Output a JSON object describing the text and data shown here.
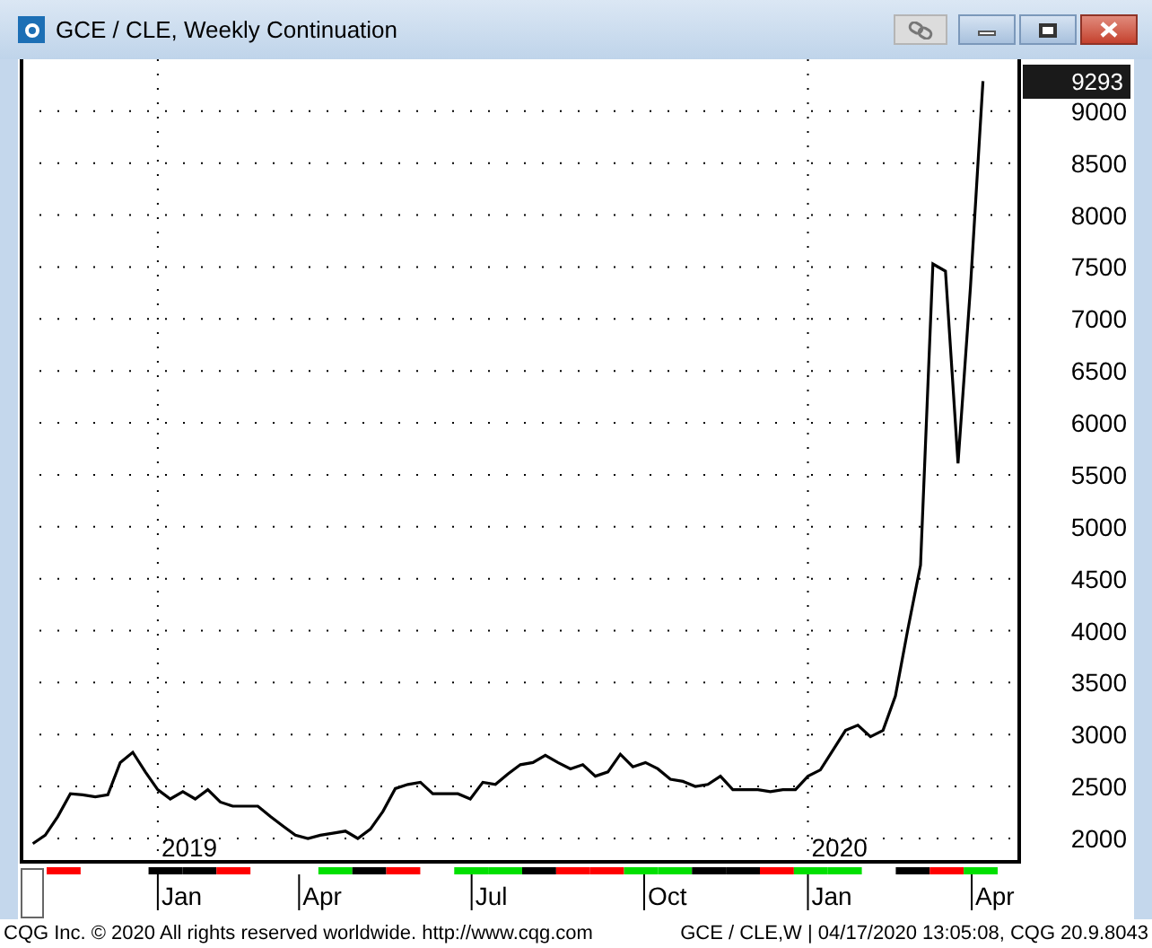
{
  "window": {
    "title": "GCE / CLE, Weekly Continuation"
  },
  "chart": {
    "last_price": "9293",
    "year_labels": [
      "2019",
      "2020"
    ],
    "time_axis": [
      {
        "label": "Jan"
      },
      {
        "label": "Apr"
      },
      {
        "label": "Jul"
      },
      {
        "label": "Oct"
      },
      {
        "label": "Jan"
      },
      {
        "label": "Apr"
      }
    ],
    "chart_data": {
      "type": "line",
      "grid": true,
      "ylim": [
        1775,
        9500
      ],
      "yticks": [
        2000,
        2500,
        3000,
        3500,
        4000,
        4500,
        5000,
        5500,
        6000,
        6500,
        7000,
        7500,
        8000,
        8500,
        9000
      ],
      "series": [
        {
          "color": "#000000",
          "values": [
            1950,
            2030,
            2210,
            2430,
            2420,
            2400,
            2420,
            2730,
            2830,
            2640,
            2470,
            2380,
            2450,
            2380,
            2470,
            2350,
            2310,
            2310,
            2310,
            2210,
            2120,
            2030,
            2000,
            2030,
            2050,
            2070,
            2000,
            2090,
            2260,
            2480,
            2520,
            2540,
            2430,
            2430,
            2430,
            2380,
            2540,
            2520,
            2620,
            2710,
            2730,
            2800,
            2730,
            2670,
            2710,
            2600,
            2640,
            2810,
            2690,
            2730,
            2670,
            2570,
            2550,
            2500,
            2520,
            2600,
            2470,
            2470,
            2470,
            2450,
            2470,
            2470,
            2600,
            2660,
            2850,
            3040,
            3090,
            2980,
            3040,
            3370,
            4020,
            4630,
            7530,
            7460,
            5610,
            7300,
            9290
          ]
        }
      ]
    }
  },
  "status_bar": {
    "left": "CQG Inc. © 2020 All rights reserved worldwide. http://www.cqg.com",
    "right": "GCE / CLE,W | 04/17/2020 13:05:08, CQG 20.9.8043"
  }
}
